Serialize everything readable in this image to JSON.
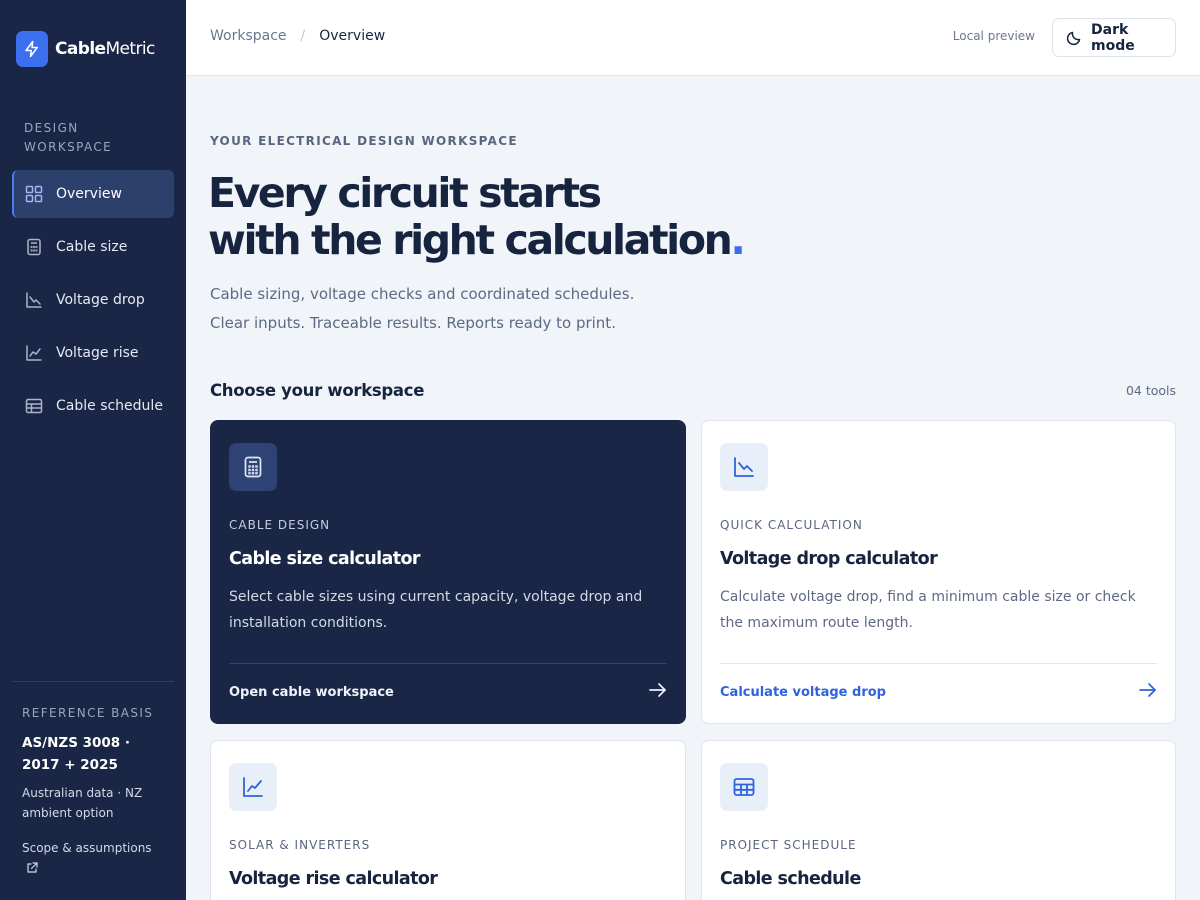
{
  "brand": {
    "name_bold": "Cable",
    "name_regular": "Metric"
  },
  "sidebar": {
    "section_title": "DESIGN WORKSPACE",
    "items": [
      {
        "label": "Overview",
        "icon": "grid-icon",
        "active": true
      },
      {
        "label": "Cable size",
        "icon": "calculator-icon"
      },
      {
        "label": "Voltage drop",
        "icon": "chart-drop-icon"
      },
      {
        "label": "Voltage rise",
        "icon": "chart-rise-icon"
      },
      {
        "label": "Cable schedule",
        "icon": "table-icon"
      }
    ],
    "reference": {
      "title": "REFERENCE BASIS",
      "standard": "AS/NZS 3008 · 2017 + 2025",
      "data": "Australian data · NZ ambient option",
      "link": "Scope & assumptions"
    }
  },
  "topbar": {
    "breadcrumb": [
      "Workspace",
      "Overview"
    ],
    "separator": "/",
    "preview_label": "Local preview",
    "dark_mode_label": "Dark mode"
  },
  "hero": {
    "eyebrow": "YOUR ELECTRICAL DESIGN WORKSPACE",
    "line1": "Every circuit starts",
    "line2": "with the right calculation",
    "dot": ".",
    "lead1": "Cable sizing, voltage checks and coordinated schedules.",
    "lead2": "Clear inputs. Traceable results. Reports ready to print."
  },
  "tools": {
    "heading": "Choose your workspace",
    "count": "04 tools",
    "cards": [
      {
        "kicker": "CABLE DESIGN",
        "title": "Cable size calculator",
        "desc": "Select cable sizes using current capacity, voltage drop and installation conditions.",
        "cta": "Open cable workspace",
        "icon": "calculator-icon"
      },
      {
        "kicker": "QUICK CALCULATION",
        "title": "Voltage drop calculator",
        "desc": "Calculate voltage drop, find a minimum cable size or check the maximum route length.",
        "cta": "Calculate voltage drop",
        "icon": "chart-drop-icon"
      },
      {
        "kicker": "SOLAR & INVERTERS",
        "title": "Voltage rise calculator",
        "icon": "chart-rise-icon"
      },
      {
        "kicker": "PROJECT SCHEDULE",
        "title": "Cable schedule",
        "icon": "table-icon"
      }
    ]
  },
  "colors": {
    "sidebar_bg": "#1a2645",
    "accent": "#3b6ff0",
    "page_bg": "#f1f4f8"
  }
}
